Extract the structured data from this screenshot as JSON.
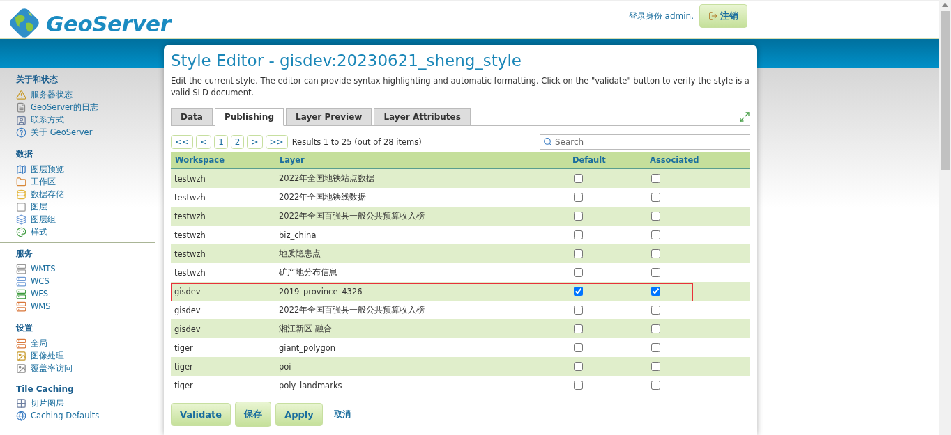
{
  "header": {
    "logo_text": "GeoServer",
    "login_text": "登录身份 admin.",
    "logout_button": "注销"
  },
  "sidebar": {
    "sections": [
      {
        "title": "关于和状态",
        "items": [
          "服务器状态",
          "GeoServer的日志",
          "联系方式",
          "关于 GeoServer"
        ]
      },
      {
        "title": "数据",
        "items": [
          "图层预览",
          "工作区",
          "数据存储",
          "图层",
          "图层组",
          "样式"
        ]
      },
      {
        "title": "服务",
        "items": [
          "WMTS",
          "WCS",
          "WFS",
          "WMS"
        ]
      },
      {
        "title": "设置",
        "items": [
          "全局",
          "图像处理",
          "覆盖率访问"
        ]
      },
      {
        "title": "Tile Caching",
        "items": [
          "切片图层",
          "Caching Defaults"
        ]
      }
    ]
  },
  "page": {
    "title": "Style Editor - gisdev:20230621_sheng_style",
    "description": "Edit the current style. The editor can provide syntax highlighting and automatic formatting. Click on the \"validate\" button to verify the style is a valid SLD document."
  },
  "tabs": [
    {
      "label": "Data",
      "selected": false
    },
    {
      "label": "Publishing",
      "selected": true
    },
    {
      "label": "Layer Preview",
      "selected": false
    },
    {
      "label": "Layer Attributes",
      "selected": false
    }
  ],
  "pager": {
    "buttons": [
      "<<",
      "<",
      "1",
      "2",
      ">",
      ">>"
    ],
    "results": "Results 1 to 25 (out of 28 items)"
  },
  "search": {
    "placeholder": "Search"
  },
  "table": {
    "columns": [
      "Workspace",
      "Layer",
      "Default",
      "Associated"
    ],
    "rows": [
      {
        "workspace": "testwzh",
        "layer": "2022年全国地铁站点数据",
        "default": false,
        "associated": false,
        "highlighted": false
      },
      {
        "workspace": "testwzh",
        "layer": "2022年全国地铁线数据",
        "default": false,
        "associated": false,
        "highlighted": false
      },
      {
        "workspace": "testwzh",
        "layer": "2022年全国百强县一般公共预算收入榜",
        "default": false,
        "associated": false,
        "highlighted": false
      },
      {
        "workspace": "testwzh",
        "layer": "biz_china",
        "default": false,
        "associated": false,
        "highlighted": false
      },
      {
        "workspace": "testwzh",
        "layer": "地质隐患点",
        "default": false,
        "associated": false,
        "highlighted": false
      },
      {
        "workspace": "testwzh",
        "layer": "矿产地分布信息",
        "default": false,
        "associated": false,
        "highlighted": false
      },
      {
        "workspace": "gisdev",
        "layer": "2019_province_4326",
        "default": true,
        "associated": true,
        "highlighted": true
      },
      {
        "workspace": "gisdev",
        "layer": "2022年全国百强县一般公共预算收入榜",
        "default": false,
        "associated": false,
        "highlighted": false
      },
      {
        "workspace": "gisdev",
        "layer": "湘江新区-融合",
        "default": false,
        "associated": false,
        "highlighted": false
      },
      {
        "workspace": "tiger",
        "layer": "giant_polygon",
        "default": false,
        "associated": false,
        "highlighted": false
      },
      {
        "workspace": "tiger",
        "layer": "poi",
        "default": false,
        "associated": false,
        "highlighted": false
      },
      {
        "workspace": "tiger",
        "layer": "poly_landmarks",
        "default": false,
        "associated": false,
        "highlighted": false
      }
    ]
  },
  "actions": [
    {
      "label": "Validate",
      "kind": "button"
    },
    {
      "label": "保存",
      "kind": "button"
    },
    {
      "label": "Apply",
      "kind": "button"
    },
    {
      "label": "取消",
      "kind": "link"
    }
  ]
}
